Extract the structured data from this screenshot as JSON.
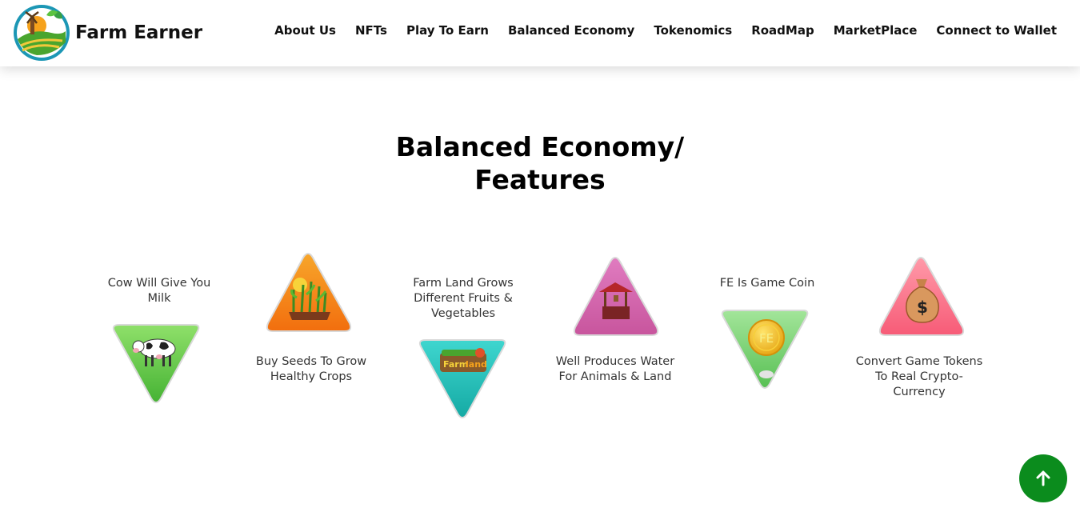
{
  "brand": {
    "name": "Farm Earner",
    "logo_icon": "farm-logo-icon"
  },
  "nav": {
    "items": [
      "About Us",
      "NFTs",
      "Play To Earn",
      "Balanced Economy",
      "Tokenomics",
      "RoadMap",
      "MarketPlace",
      "Connect to Wallet"
    ]
  },
  "section": {
    "title_line1": "Balanced Economy/",
    "title_line2": "Features"
  },
  "features": [
    {
      "text_line1": "Cow Will Give You",
      "text_line2": "Milk",
      "icon": "cow-icon",
      "color": "#5cc341"
    },
    {
      "text_line1": "Buy Seeds To Grow",
      "text_line2": "Healthy Crops",
      "icon": "crops-icon",
      "color": "#f47a12"
    },
    {
      "text_line1": "Farm Land Grows",
      "text_line2": "Different Fruits &",
      "text_line3": "Vegetables",
      "icon": "farmland-icon",
      "color": "#1fbfb8"
    },
    {
      "text_line1": "Well Produces Water",
      "text_line2": "For Animals & Land",
      "icon": "well-icon",
      "color": "#d262a8"
    },
    {
      "text_line1": "FE Is Game Coin",
      "icon": "coin-icon",
      "coin_label": "FE",
      "color": "#71cf71"
    },
    {
      "text_line1": "Convert Game Tokens",
      "text_line2": "To Real Crypto-",
      "text_line3": "Currency",
      "icon": "money-bag-icon",
      "color": "#fb7389"
    }
  ],
  "scroll_top": {
    "icon": "arrow-up-icon",
    "color": "#0b8c1d"
  }
}
